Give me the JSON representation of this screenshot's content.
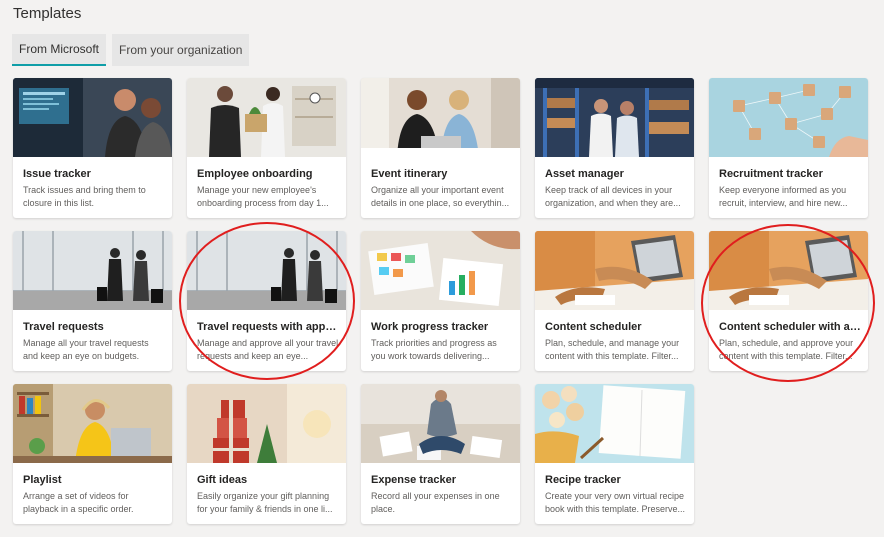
{
  "page": {
    "title": "Templates"
  },
  "tabs": [
    {
      "label": "From Microsoft",
      "active": true
    },
    {
      "label": "From your organization",
      "active": false
    }
  ],
  "templates": [
    {
      "title": "Issue tracker",
      "description": "Track issues and bring them to closure in this list."
    },
    {
      "title": "Employee onboarding",
      "description": "Manage your new employee's onboarding process from day 1..."
    },
    {
      "title": "Event itinerary",
      "description": "Organize all your important event details in one place, so everythin..."
    },
    {
      "title": "Asset manager",
      "description": "Keep track of all devices in your organization, and when they are..."
    },
    {
      "title": "Recruitment tracker",
      "description": "Keep everyone informed as you recruit, interview, and hire new..."
    },
    {
      "title": "Travel requests",
      "description": "Manage all your travel requests and keep an eye on budgets."
    },
    {
      "title": "Travel requests with approv...",
      "description": "Manage and approve all your travel requests and keep an eye..."
    },
    {
      "title": "Work progress tracker",
      "description": "Track priorities and progress as you work towards delivering..."
    },
    {
      "title": "Content scheduler",
      "description": "Plan, schedule, and manage your content with this template. Filter..."
    },
    {
      "title": "Content scheduler with ap...",
      "description": "Plan, schedule, and approve your content with this template. Filter..."
    },
    {
      "title": "Playlist",
      "description": "Arrange a set of videos for playback in a specific order."
    },
    {
      "title": "Gift ideas",
      "description": "Easily organize your gift planning for your family & friends in one li..."
    },
    {
      "title": "Expense tracker",
      "description": "Record all your expenses in one place."
    },
    {
      "title": "Recipe tracker",
      "description": "Create your very own virtual recipe book with this template. Preserve..."
    }
  ],
  "colors": {
    "accent": "#0f9ea8",
    "annotation": "#e01e1e",
    "background": "#f3f2f1"
  }
}
